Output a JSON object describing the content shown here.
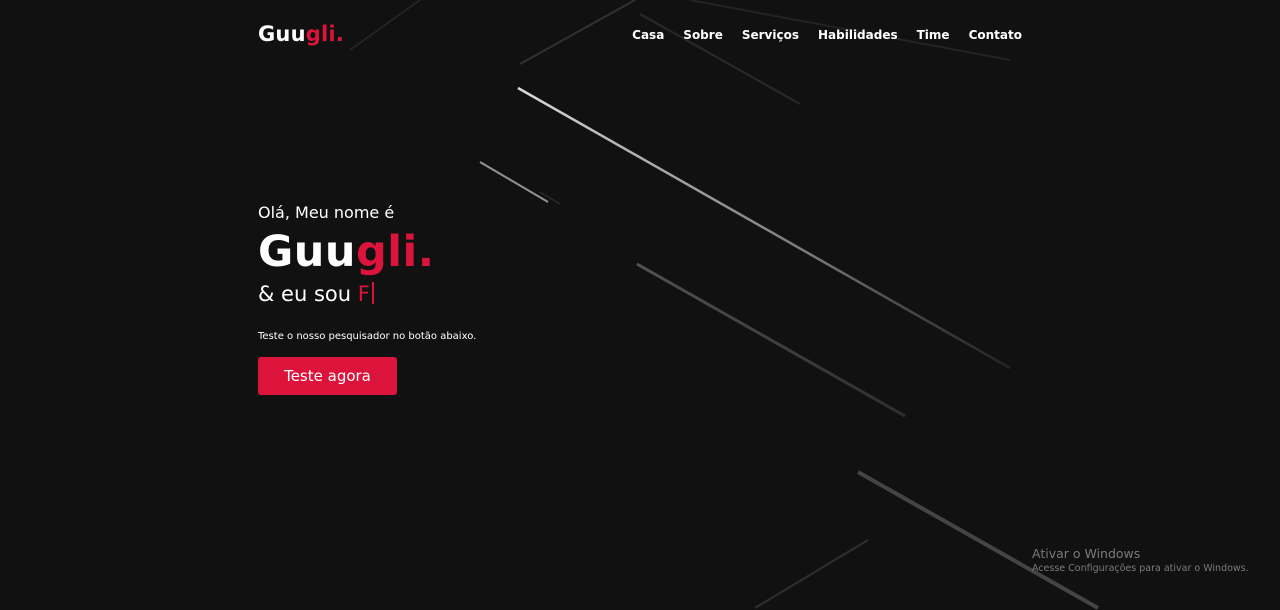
{
  "brand": {
    "name_main": "Guu",
    "name_accent": "gli.",
    "accent_color": "#dc143c",
    "background_color": "#111111"
  },
  "nav": {
    "items": [
      "Casa",
      "Sobre",
      "Serviços",
      "Habilidades",
      "Time",
      "Contato"
    ]
  },
  "hero": {
    "greeting": "Olá, Meu nome é",
    "name_main": "Guu",
    "name_accent": "gli.",
    "role_prefix": "& eu sou ",
    "role_typed": "F",
    "description": "Teste o nosso pesquisador no botão abaixo.",
    "button_label": "Teste agora"
  },
  "watermark": {
    "title": "Ativar o Windows",
    "subtitle": "Acesse Configurações para ativar o Windows."
  }
}
